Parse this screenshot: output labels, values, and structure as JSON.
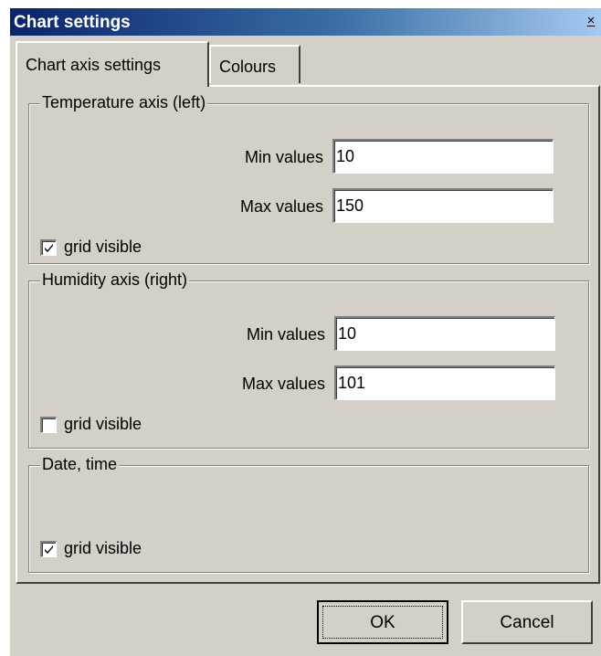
{
  "window": {
    "title": "Chart settings",
    "close_label": "×"
  },
  "tabs": [
    {
      "label": "Chart axis settings",
      "selected": true
    },
    {
      "label": "Colours",
      "selected": false
    }
  ],
  "groups": {
    "temperature": {
      "legend": "Temperature axis (left)",
      "min_label": "Min values",
      "min_value": "10",
      "max_label": "Max values",
      "max_value": "150",
      "grid_label": "grid visible",
      "grid_checked": true
    },
    "humidity": {
      "legend": "Humidity axis (right)",
      "min_label": "Min values",
      "min_value": "10",
      "max_label": "Max values",
      "max_value": "101",
      "grid_label": "grid visible",
      "grid_checked": false
    },
    "datetime": {
      "legend": "Date, time",
      "grid_label": "grid visible",
      "grid_checked": true
    }
  },
  "buttons": {
    "ok_label": "OK",
    "cancel_label": "Cancel"
  },
  "colors": {
    "face": "#d4d0c8",
    "title_start": "#0a246a",
    "title_end": "#a6caf0"
  }
}
